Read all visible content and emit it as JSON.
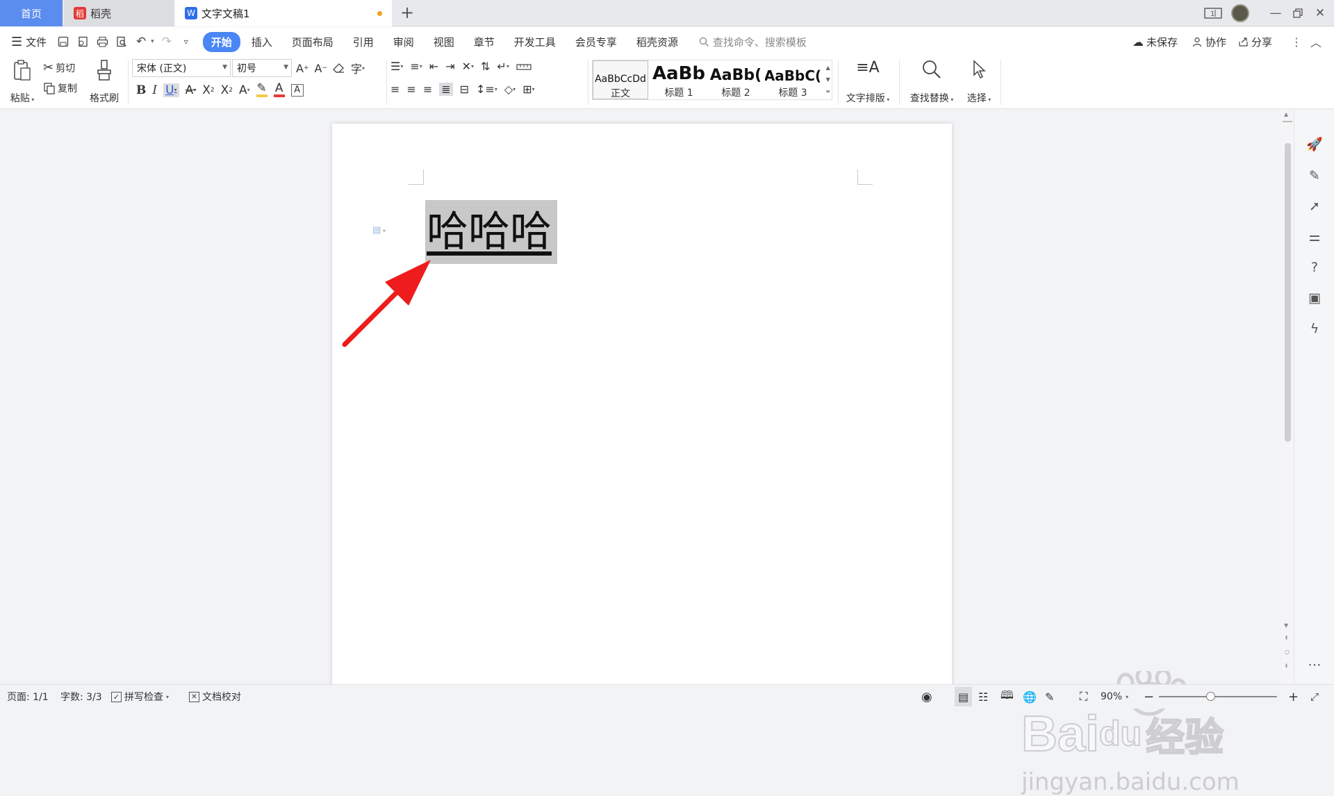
{
  "tabs": {
    "home": "首页",
    "daoke": "稻壳",
    "doc": "文字文稿1"
  },
  "menu": {
    "file": "文件",
    "items": [
      "开始",
      "插入",
      "页面布局",
      "引用",
      "审阅",
      "视图",
      "章节",
      "开发工具",
      "会员专享",
      "稻壳资源"
    ],
    "search_placeholder": "查找命令、搜索模板",
    "unsaved": "未保存",
    "collab": "协作",
    "share": "分享"
  },
  "ribbon": {
    "paste": "粘贴",
    "cut": "剪切",
    "copy": "复制",
    "format_painter": "格式刷",
    "font_name": "宋体 (正文)",
    "font_size": "初号",
    "styles": [
      {
        "preview": "AaBbCcDd",
        "name": "正文"
      },
      {
        "preview": "AaBb",
        "name": "标题 1"
      },
      {
        "preview": "AaBb(",
        "name": "标题 2"
      },
      {
        "preview": "AaBbC(",
        "name": "标题 3"
      }
    ],
    "text_layout": "文字排版",
    "find_replace": "查找替换",
    "select": "选择"
  },
  "document": {
    "text": "哈哈哈"
  },
  "status": {
    "page": "页面: 1/1",
    "words": "字数: 3/3",
    "spell_check": "拼写检查",
    "doc_proof": "文档校对",
    "zoom": "90%"
  },
  "watermark": {
    "brand": "Bai",
    "brand2": "du",
    "cn": "经验",
    "url": "jingyan.baidu.com"
  },
  "colors": {
    "accent": "#4a86f5",
    "home_tab": "#5b8def",
    "daoke_logo": "#e53935",
    "arrow": "#ee1c1c",
    "highlight_bar": "#f2c94c",
    "font_color_bar": "#e53935",
    "selection": "#c8c8c8"
  }
}
